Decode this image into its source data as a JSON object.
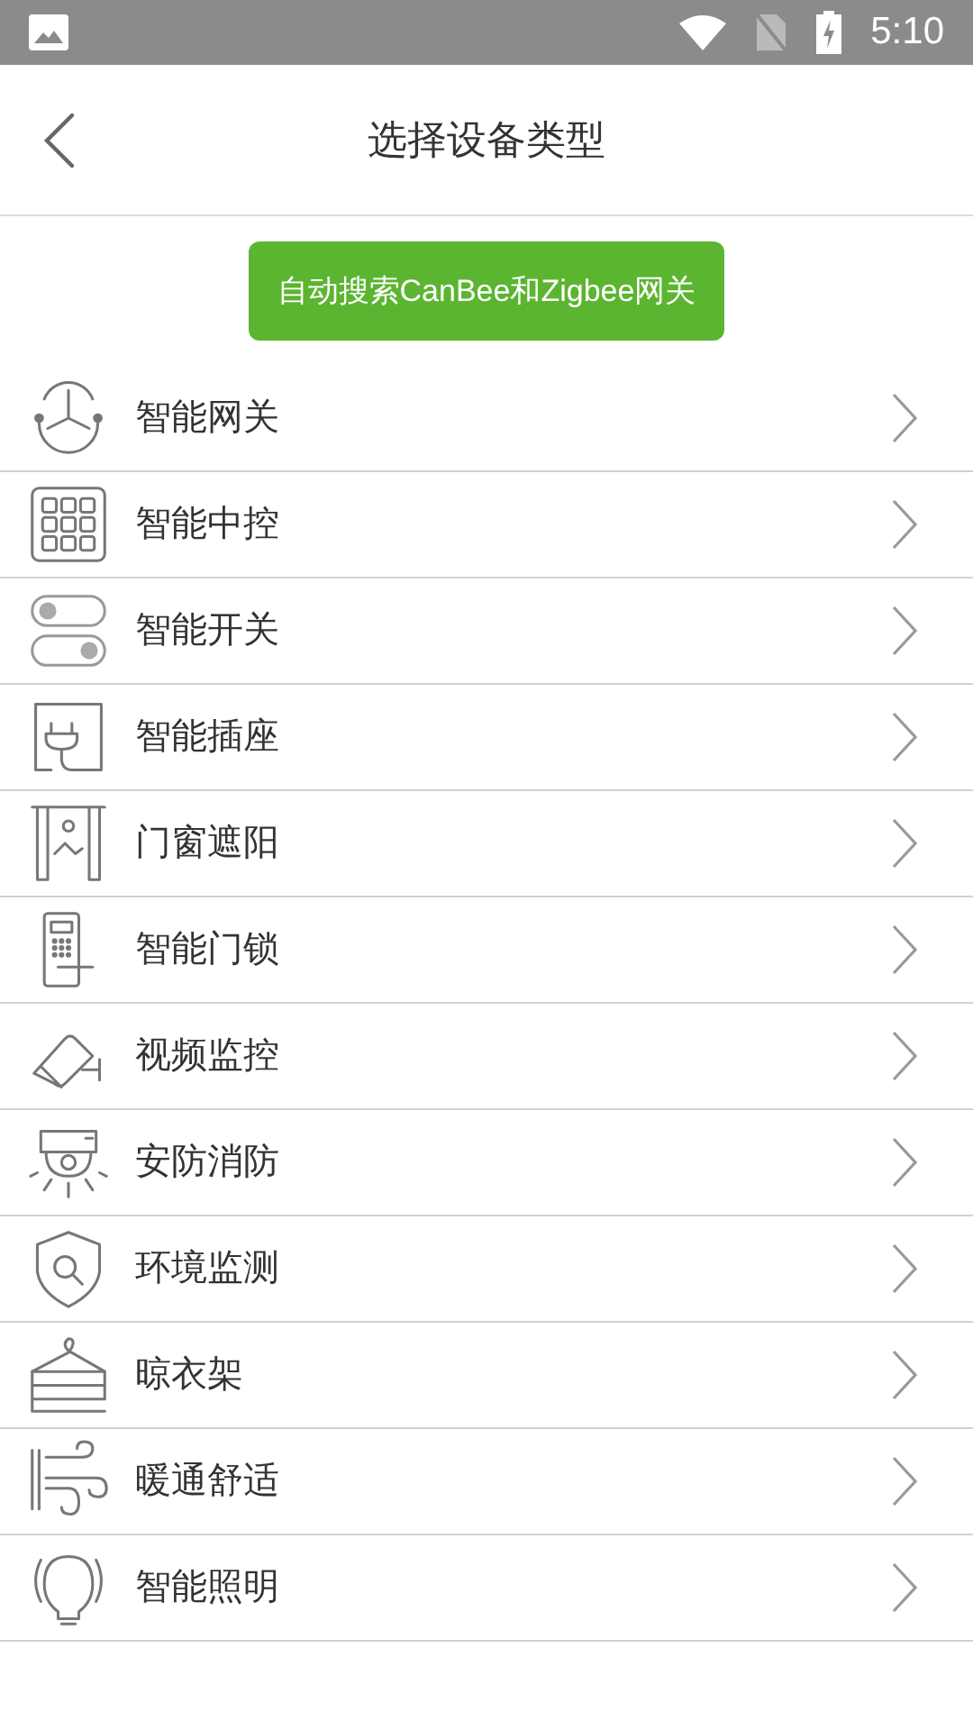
{
  "status_bar": {
    "time": "5:10"
  },
  "header": {
    "title": "选择设备类型"
  },
  "search_button": {
    "label": "自动搜索CanBee和Zigbee网关"
  },
  "device_types": [
    {
      "label": "智能网关"
    },
    {
      "label": "智能中控"
    },
    {
      "label": "智能开关"
    },
    {
      "label": "智能插座"
    },
    {
      "label": "门窗遮阳"
    },
    {
      "label": "智能门锁"
    },
    {
      "label": "视频监控"
    },
    {
      "label": "安防消防"
    },
    {
      "label": "环境监测"
    },
    {
      "label": "晾衣架"
    },
    {
      "label": "暖通舒适"
    },
    {
      "label": "智能照明"
    }
  ]
}
